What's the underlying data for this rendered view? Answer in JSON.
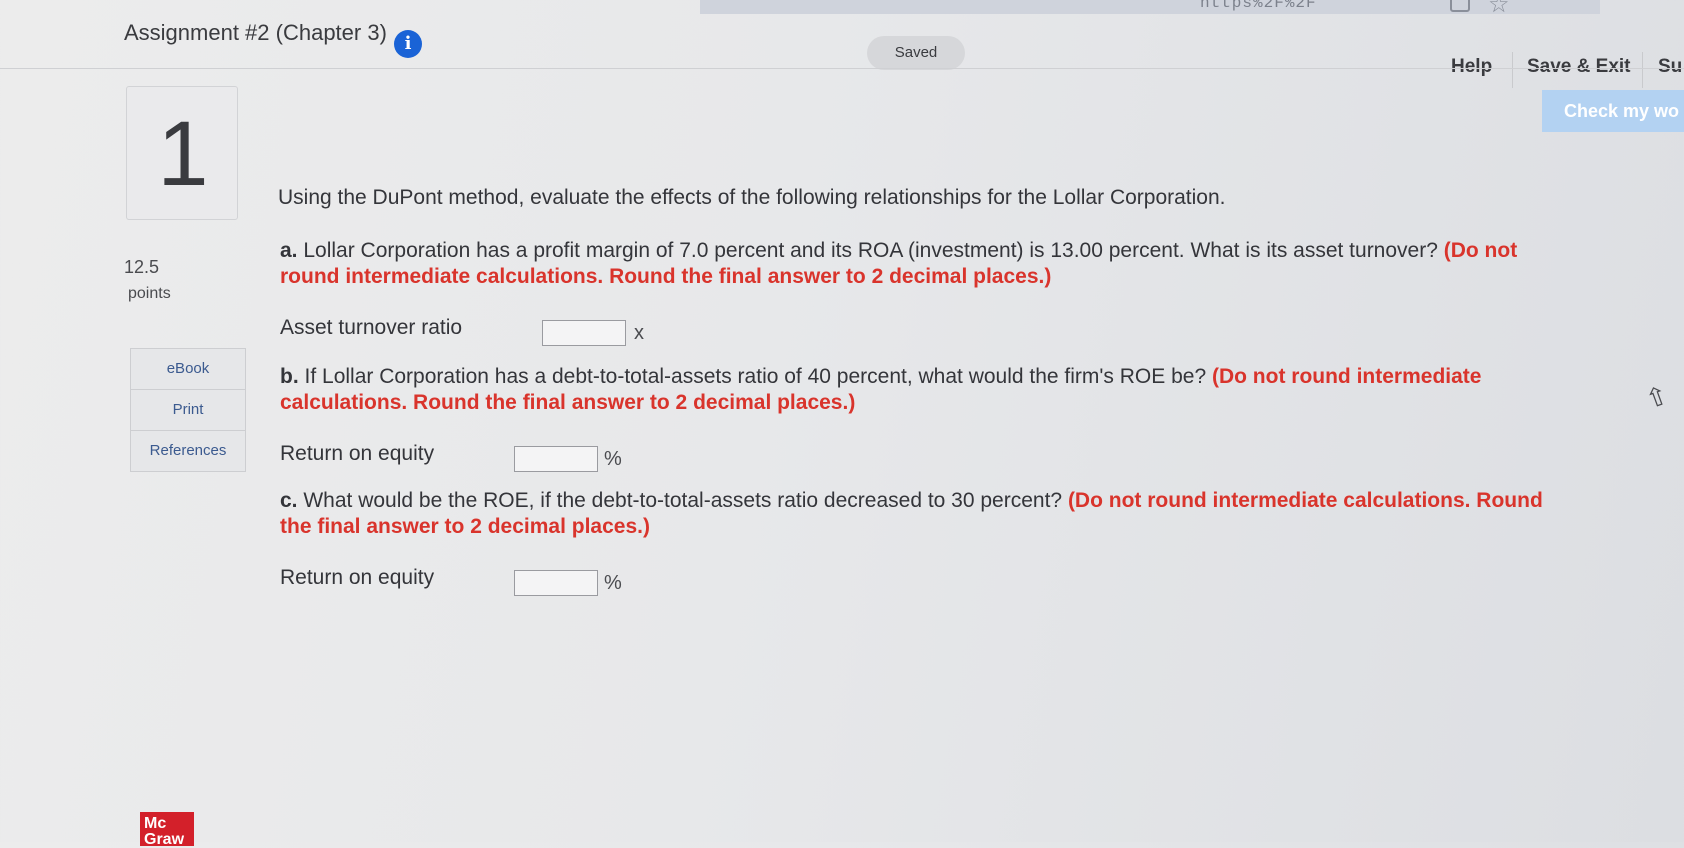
{
  "header": {
    "url_fragment": "https%2F%2F",
    "assignment_title": "Assignment #2 (Chapter 3)",
    "info_icon": "info-icon",
    "status": "Saved",
    "nav": {
      "help": "Help",
      "save_exit": "Save & Exit",
      "submit": "Su"
    }
  },
  "question": {
    "number": "1",
    "points_value": "12.5",
    "points_label": "points",
    "check_button": "Check my wo",
    "tools": [
      "eBook",
      "Print",
      "References"
    ],
    "intro": "Using the DuPont method, evaluate the effects of the following relationships for the Lollar Corporation.",
    "parts": [
      {
        "letter": "a.",
        "text": " Lollar Corporation has a profit margin of 7.0 percent and its ROA (investment) is 13.00 percent. What is its asset turnover? ",
        "instruction": "(Do not round intermediate calculations. Round the final answer to 2 decimal places.)",
        "answer_label": "Asset turnover ratio",
        "answer_value": "",
        "unit": "x"
      },
      {
        "letter": "b.",
        "text": " If Lollar Corporation has a debt-to-total-assets ratio of 40 percent, what would the firm's ROE be? ",
        "instruction": "(Do not round intermediate calculations. Round the final answer to 2 decimal places.)",
        "answer_label": "Return on equity",
        "answer_value": "",
        "unit": "%"
      },
      {
        "letter": "c.",
        "text": " What would be the ROE, if the debt-to-total-assets ratio decreased to 30 percent? ",
        "instruction": "(Do not round intermediate calculations. Round the final answer to 2 decimal places.)",
        "answer_label": "Return on equity",
        "answer_value": "",
        "unit": "%"
      }
    ]
  },
  "footer": {
    "logo": "Mc Graw"
  },
  "colors": {
    "accent_blue": "#1a63d6",
    "instruction_red": "#d9342c",
    "check_button_bg": "#b3d2f2"
  }
}
